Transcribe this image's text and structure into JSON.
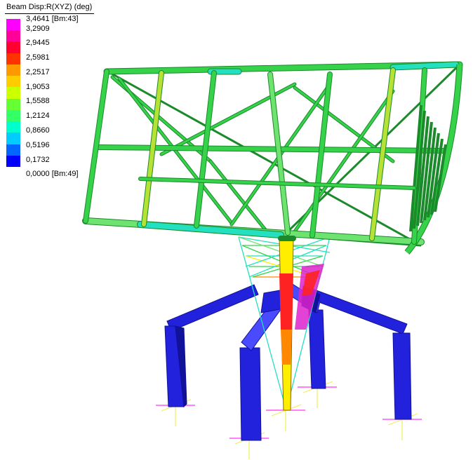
{
  "legend": {
    "title": "Beam Disp:R(XYZ) (deg)",
    "labels": [
      "3,4641 [Bm:43]",
      "3,2909",
      "2,9445",
      "2,5981",
      "2,2517",
      "1,9053",
      "1,5588",
      "1,2124",
      "0,8660",
      "0,5196",
      "0,1732",
      "0,0000 [Bm:49]"
    ],
    "colors": [
      "#ff00ff",
      "#ff0099",
      "#ff0033",
      "#ff3300",
      "#ff9900",
      "#ffcc00",
      "#ccff00",
      "#66ff33",
      "#33ff66",
      "#00ffcc",
      "#00ccff",
      "#0066ff",
      "#0000ff"
    ]
  },
  "model": {
    "colors": {
      "frame": "#35d24a",
      "frame_dark": "#1a8a2a",
      "frame_light": "#6fe36f",
      "cyan": "#22e0c0",
      "yellowgreen": "#b5e234",
      "support": "#2222dd",
      "support_dark": "#111199",
      "support_light": "#4a4aff",
      "hot_red": "#ff2222",
      "hot_orange": "#ff8800",
      "hot_yellow": "#ffee00",
      "hot_magenta": "#dd22cc",
      "restraint_magenta": "#ff33ff",
      "restraint_yellow": "#eeee55"
    }
  }
}
